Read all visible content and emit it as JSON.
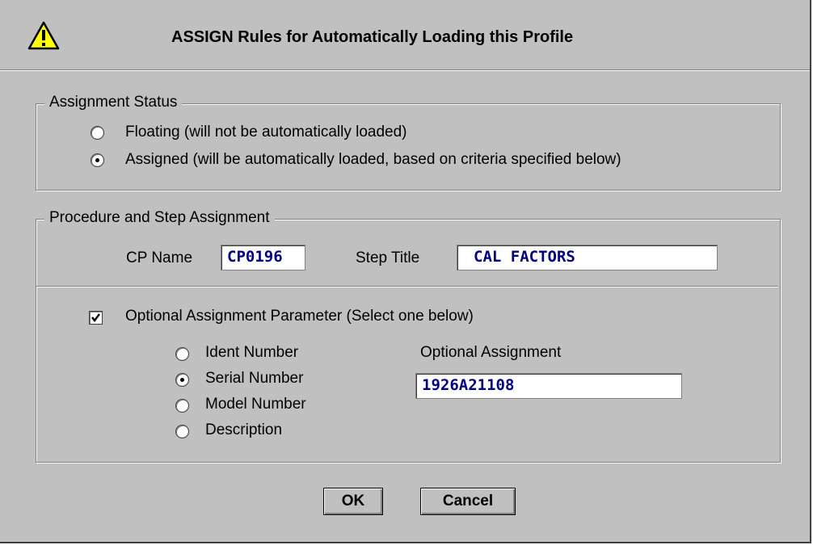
{
  "dialog": {
    "title": "ASSIGN Rules for Automatically Loading this Profile",
    "icon": "warning-icon"
  },
  "assignment_status": {
    "legend": "Assignment Status",
    "options": [
      {
        "label": "Floating  (will not be automatically loaded)",
        "selected": false
      },
      {
        "label": "Assigned  (will be automatically loaded, based on criteria specified below)",
        "selected": true
      }
    ]
  },
  "procedure": {
    "legend": "Procedure and Step Assignment",
    "cp_name_label": "CP Name",
    "cp_name_value": "CP0196",
    "step_title_label": "Step Title",
    "step_title_value": "CAL FACTORS"
  },
  "optional": {
    "checkbox_label": "Optional Assignment Parameter  (Select one below)",
    "checked": true,
    "options": [
      {
        "label": "Ident Number",
        "selected": false
      },
      {
        "label": "Serial Number",
        "selected": true
      },
      {
        "label": "Model Number",
        "selected": false
      },
      {
        "label": "Description",
        "selected": false
      }
    ],
    "assignment_label": "Optional Assignment",
    "assignment_value": "1926A21108"
  },
  "buttons": {
    "ok": "OK",
    "cancel": "Cancel"
  }
}
